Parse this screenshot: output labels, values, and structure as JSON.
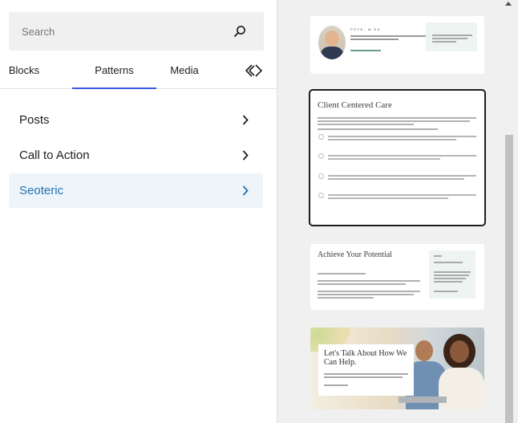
{
  "search": {
    "placeholder": "Search"
  },
  "tabs": [
    {
      "label": "Blocks"
    },
    {
      "label": "Patterns"
    },
    {
      "label": "Media"
    }
  ],
  "categories": [
    {
      "label": "Posts"
    },
    {
      "label": "Call to Action"
    },
    {
      "label": "Seoteric"
    }
  ],
  "patterns": [
    {
      "name_line": "PSYD, M.Ed"
    },
    {
      "title": "Client Centered Care"
    },
    {
      "title": "Achieve Your Potential"
    },
    {
      "title": "Let's Talk About How We Can Help."
    }
  ],
  "colors": {
    "accent": "#3858e9",
    "selected_category": "#2271b1",
    "selected_bg": "#eef5fa"
  }
}
